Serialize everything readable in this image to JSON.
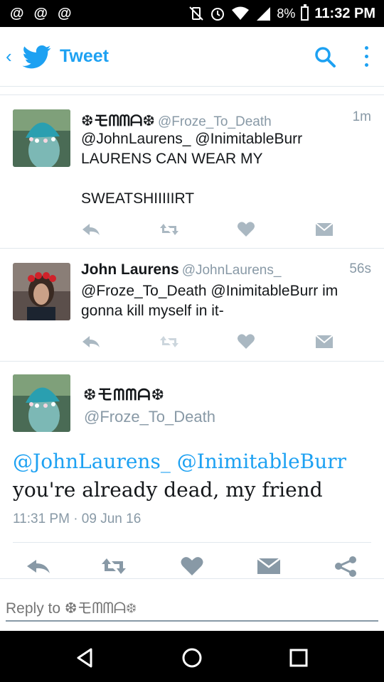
{
  "status_bar": {
    "notification_icons": [
      "@",
      "@",
      "@"
    ],
    "battery": "8%",
    "time": "11:32 PM"
  },
  "app_bar": {
    "back": "‹",
    "title": "Tweet"
  },
  "replies": [
    {
      "name": "❆モᗰᗰᗩ❆",
      "handle": "@Froze_To_Death",
      "time": "1m",
      "text": "@JohnLaurens_ @InimitableBurr\nLAURENS CAN WEAR MY\n\nSWEATSHIIIIIRT"
    },
    {
      "name": "John Laurens",
      "handle": "@JohnLaurens_",
      "time": "56s",
      "text": "@Froze_To_Death @InimitableBurr im gonna kill myself in it-"
    }
  ],
  "main_tweet": {
    "name": "❆モᗰᗰᗩ❆",
    "handle": "@Froze_To_Death",
    "mention_1": "@JohnLaurens_",
    "mention_2": "@InimitableBurr",
    "text": "you're already dead, my friend",
    "timestamp": "11:31 PM · 09 Jun 16"
  },
  "reply_bar": {
    "placeholder": "Reply to ❆モᗰᗰᗩ❆"
  },
  "colors": {
    "accent": "#1da1f2",
    "muted": "#8899a6",
    "divider": "#e1e8ed"
  }
}
